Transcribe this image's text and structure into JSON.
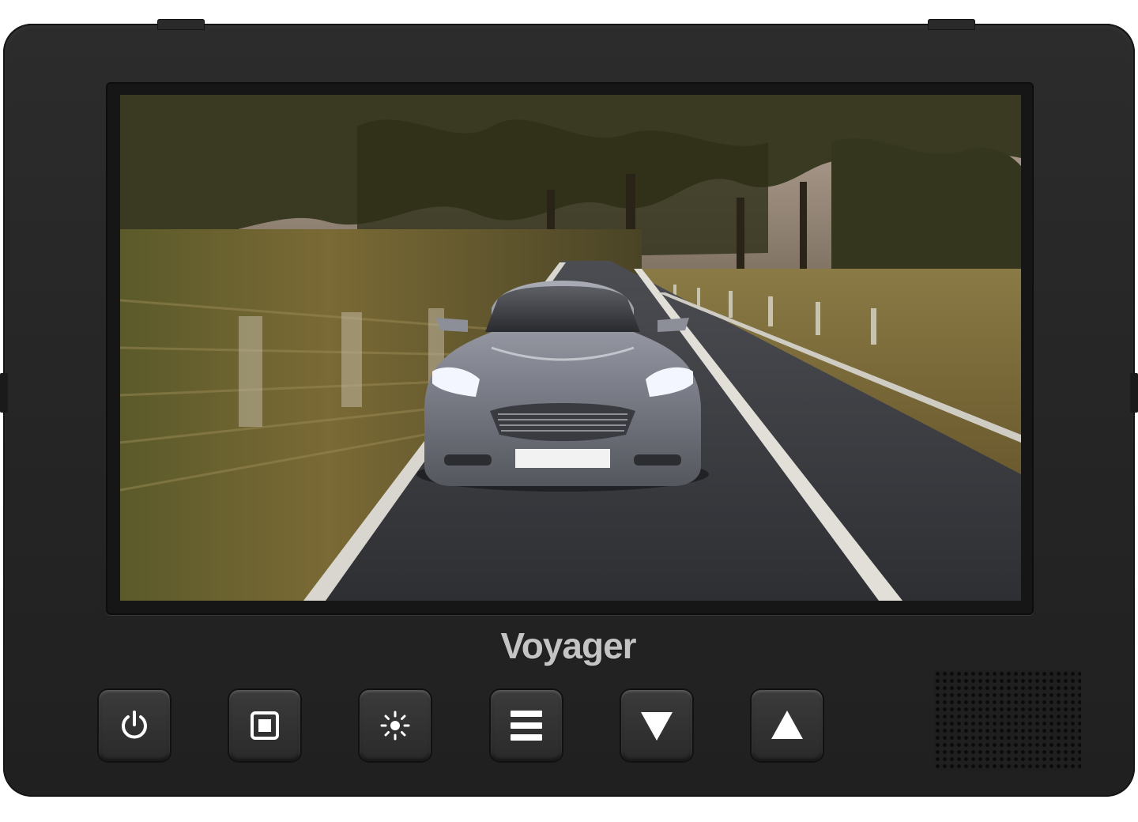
{
  "device": {
    "brand": "Voyager",
    "screen_image": "car-driving-on-country-road-photo",
    "bezel_color": "#262626",
    "screen_border_color": "#161616"
  },
  "buttons": [
    {
      "name": "power-button",
      "icon": "power-icon"
    },
    {
      "name": "source-button",
      "icon": "square-icon"
    },
    {
      "name": "brightness-button",
      "icon": "sun-icon"
    },
    {
      "name": "menu-button",
      "icon": "menu-icon"
    },
    {
      "name": "down-button",
      "icon": "triangle-down-icon"
    },
    {
      "name": "up-button",
      "icon": "triangle-up-icon"
    }
  ],
  "speaker": {
    "icon": "speaker-grille"
  }
}
